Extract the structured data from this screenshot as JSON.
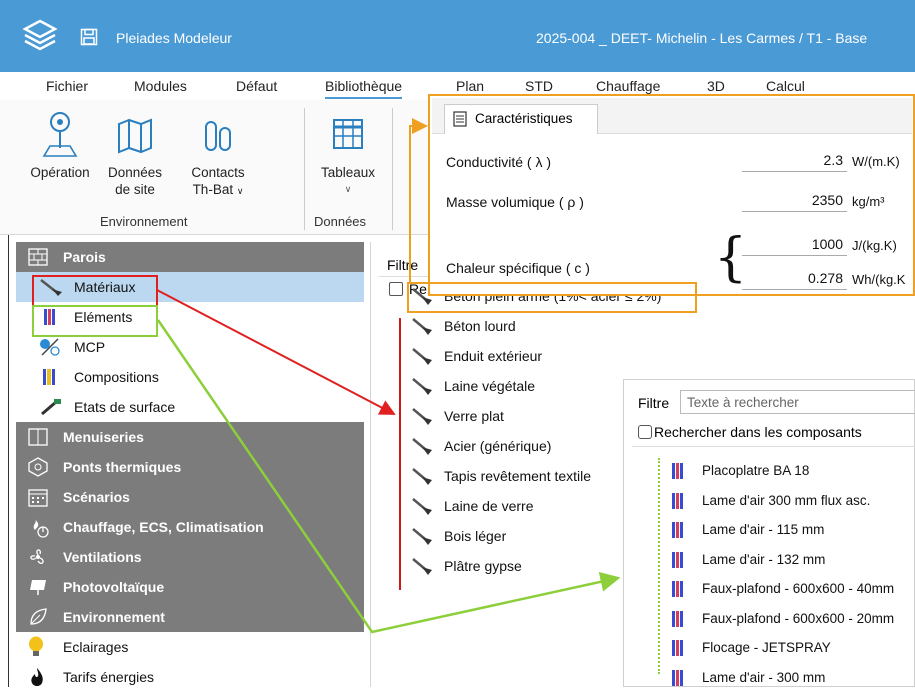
{
  "app": {
    "name": "Pleiades Modeleur",
    "project": "2025-004 _ DEET- Michelin - Les Carmes / T1 - Base"
  },
  "ribbon_tabs": [
    "Fichier",
    "Modules",
    "Défaut",
    "Bibliothèque",
    "Plan",
    "STD",
    "Chauffage",
    "3D",
    "Calcul"
  ],
  "ribbon": {
    "operation": "Opération",
    "donnees_site_1": "Données",
    "donnees_site_2": "de site",
    "contacts_1": "Contacts",
    "contacts_2": "Th-Bat",
    "tableaux": "Tableaux",
    "group_env": "Environnement",
    "group_donnees": "Données"
  },
  "sidebar": {
    "parois": "Parois",
    "materiaux": "Matériaux",
    "elements": "Eléments",
    "mcp": "MCP",
    "compositions": "Compositions",
    "etats": "Etats de surface",
    "menuiseries": "Menuiseries",
    "ponts": "Ponts thermiques",
    "scenarios": "Scénarios",
    "chauffage": "Chauffage, ECS, Climatisation",
    "ventilations": "Ventilations",
    "photovoltaique": "Photovoltaïque",
    "environnement": "Environnement",
    "eclairages": "Eclairages",
    "tarifs": "Tarifs énergies"
  },
  "materials_panel": {
    "filter": "Filtre",
    "checkbox_partial": "Re",
    "items": [
      "Béton plein armé (1%< acier ≤ 2%)",
      "Béton lourd",
      "Enduit extérieur",
      "Laine végétale",
      "Verre plat",
      "Acier (générique)",
      "Tapis revêtement textile",
      "Laine de verre",
      "Bois léger",
      "Plâtre gypse"
    ]
  },
  "characteristics": {
    "tab": "Caractéristiques",
    "conductivite_label": "Conductivité ( λ )",
    "conductivite_value": "2.3",
    "conductivite_unit": "W/(m.K)",
    "masse_label": "Masse volumique ( ρ )",
    "masse_value": "2350",
    "masse_unit": "kg/m³",
    "chaleur_label": "Chaleur spécifique ( c )",
    "chaleur_value_1": "1000",
    "chaleur_unit_1": "J/(kg.K)",
    "chaleur_value_2": "0.278",
    "chaleur_unit_2": "Wh/(kg.K"
  },
  "elements_panel": {
    "filter": "Filtre",
    "search_placeholder": "Texte à rechercher",
    "checkbox": "Rechercher dans les composants",
    "items": [
      "Placoplatre BA 18",
      "Lame d'air 300 mm flux asc.",
      "Lame d'air - 115 mm",
      "Lame d'air - 132 mm",
      "Faux-plafond - 600x600 - 40mm",
      "Faux-plafond - 600x600 - 20mm",
      "Flocage - JETSPRAY",
      "Lame d'air - 300 mm"
    ]
  },
  "colors": {
    "titlebar": "#4a9ad6",
    "category": "#7c7c7c",
    "selected": "#bcd8f0",
    "orange": "#f0a020",
    "green": "#8ccf3a",
    "red": "#e02020"
  }
}
